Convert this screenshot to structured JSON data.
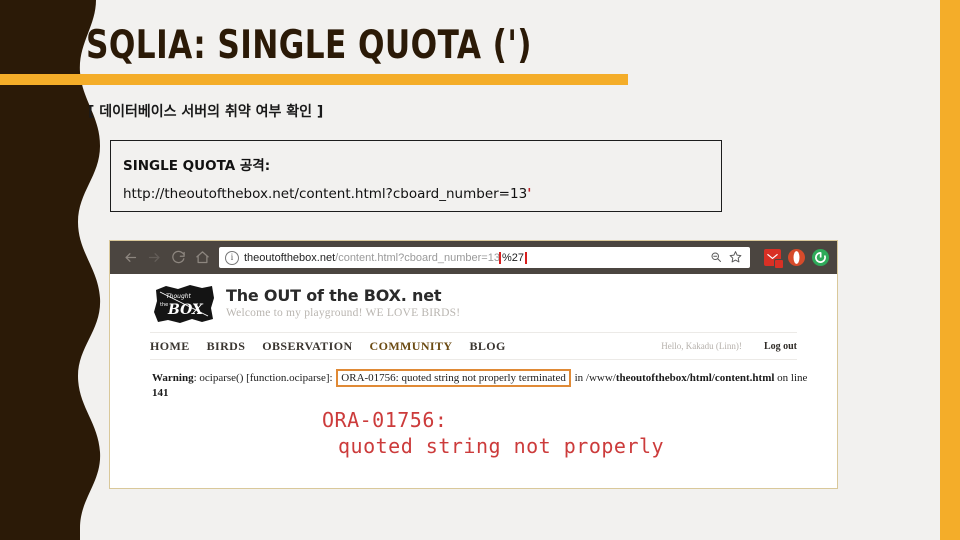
{
  "slide": {
    "title": "SQLIA: SINGLE QUOTA (')",
    "subhead": "[ 데이터베이스 서버의 취약 여부 확인 ]",
    "accent_color": "#f4ad29",
    "dark_color": "#2b1a07",
    "background_color": "#f2f1ef"
  },
  "command_box": {
    "heading": "SINGLE QUOTA 공격:",
    "url_base": "http://theoutofthebox.net/content.html?cboard_number=13",
    "url_quote": "'",
    "quote_color": "#c0272d"
  },
  "browser": {
    "toolbar": {
      "back_icon": "back-arrow-icon",
      "forward_icon": "forward-arrow-icon",
      "reload_icon": "reload-icon",
      "home_icon": "home-icon",
      "info_icon": "info-circle-icon",
      "zoom_icon": "zoom-out-icon",
      "bookmark_icon": "star-icon"
    },
    "address": {
      "host": "theoutofthebox.net",
      "host_bold_part": "net",
      "path": "/content.html?cboard_number=13",
      "highlight": "%27",
      "highlight_border_color": "#d81f1f"
    },
    "extensions": [
      {
        "name": "gmail-extension-icon",
        "glyph": "M",
        "badge": true
      },
      {
        "name": "opera-extension-icon",
        "glyph": "0",
        "badge": false
      },
      {
        "name": "green-extension-icon",
        "glyph": "C",
        "badge": false
      }
    ]
  },
  "site": {
    "logo_alt": "thought-out-of-the-box-logo",
    "brand_name": "The OUT of the BOX. net",
    "brand_tagline": "Welcome to my playground! WE LOVE BIRDS!",
    "nav": [
      {
        "label": "HOME",
        "active": false
      },
      {
        "label": "BIRDS",
        "active": false
      },
      {
        "label": "OBSERVATION",
        "active": false
      },
      {
        "label": "COMMUNITY",
        "active": true
      },
      {
        "label": "BLOG",
        "active": false
      }
    ],
    "user_greeting": "Hello, Kakadu (Linn)!",
    "logout_label": "Log out",
    "warning": {
      "prefix_label": "Warning",
      "prefix_rest": ": ociparse() [function.ociparse]: ",
      "highlighted": "ORA-01756: quoted string not properly terminated",
      "suffix_pre": " in /www/",
      "suffix_bold": "theoutofthebox/html/content.html",
      "suffix_post": " on line ",
      "line_number": "141",
      "highlight_border_color": "#e08a36"
    },
    "big_error": {
      "line1": "ORA-01756:",
      "line2": "quoted string not properly",
      "color": "#cc3b3b"
    }
  }
}
